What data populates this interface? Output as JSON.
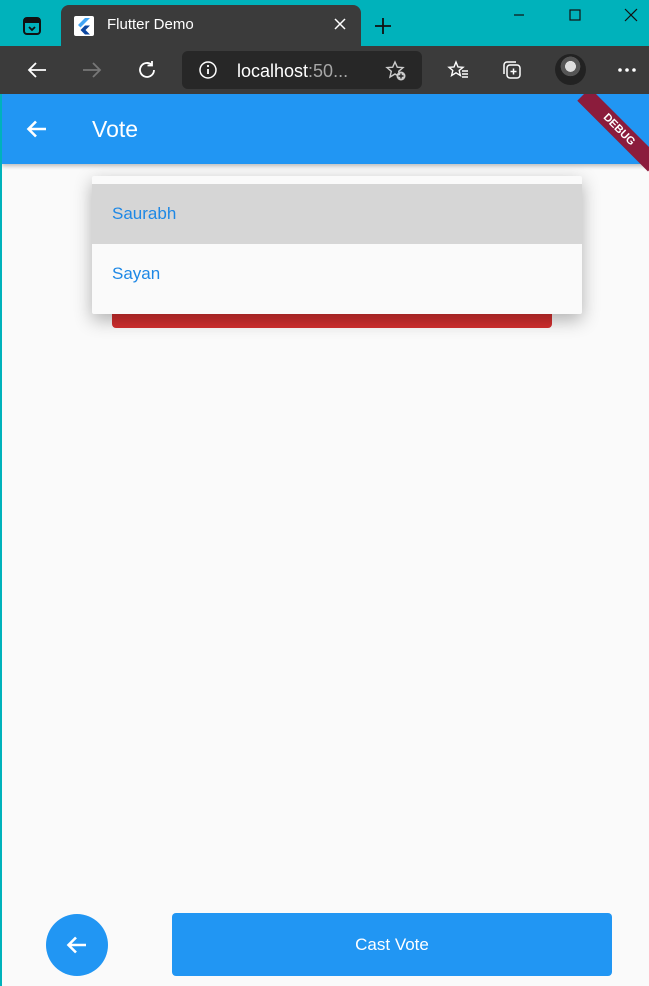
{
  "browser": {
    "tab_title": "Flutter Demo",
    "address_host": "localhost",
    "address_rest": ":50...",
    "icons": [
      "tab-actions-icon",
      "flutter-logo-icon",
      "close-icon",
      "plus-icon",
      "minimize-icon",
      "maximize-icon",
      "window-close-icon",
      "back-arrow-icon",
      "forward-arrow-icon",
      "refresh-icon",
      "info-icon",
      "add-favorite-icon",
      "favorites-icon",
      "collections-icon",
      "avatar",
      "more-icon"
    ]
  },
  "app": {
    "title": "Vote",
    "debug_label": "DEBUG",
    "dropdown_options": [
      {
        "label": "Saurabh",
        "selected": true
      },
      {
        "label": "Sayan",
        "selected": false
      }
    ],
    "cast_vote_label": "Cast Vote",
    "colors": {
      "primary": "#2196f3",
      "dropdown_text": "#1e88e5",
      "underlay_red": "#d32f2f",
      "debug_banner": "#8b1c3c",
      "browser_frame": "#00b2bb"
    }
  }
}
